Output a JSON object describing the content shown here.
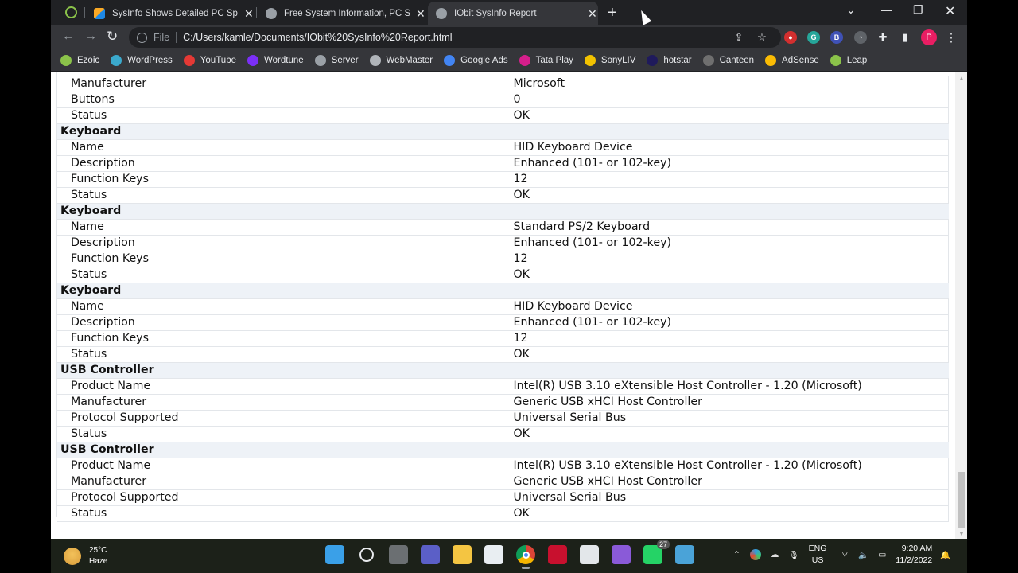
{
  "browser": {
    "tabs": [
      {
        "title": "SysInfo Shows Detailed PC Specs",
        "favicon": "sysinfo-favicon",
        "active": false
      },
      {
        "title": "Free System Information, PC Spe",
        "favicon": "globe-icon",
        "active": false
      },
      {
        "title": "IObit SysInfo Report",
        "favicon": "globe-icon",
        "active": true
      }
    ],
    "new_tab_label": "+",
    "address": {
      "scheme_label": "File",
      "url": "C:/Users/kamle/Documents/IObit%20SysInfo%20Report.html"
    },
    "profile_initial": "P",
    "bookmarks": [
      {
        "label": "Ezoic",
        "icon": "ezoic-icon",
        "color": "#8bc34a"
      },
      {
        "label": "WordPress",
        "icon": "wordpress-icon",
        "color": "#3ba9cc"
      },
      {
        "label": "YouTube",
        "icon": "youtube-icon",
        "color": "#e53935"
      },
      {
        "label": "Wordtune",
        "icon": "wordtune-icon",
        "color": "#7b2ff7"
      },
      {
        "label": "Server",
        "icon": "globe-icon",
        "color": "#9aa0a6"
      },
      {
        "label": "WebMaster",
        "icon": "webmaster-icon",
        "color": "#b0b4b9"
      },
      {
        "label": "Google Ads",
        "icon": "google-ads-icon",
        "color": "#4285f4"
      },
      {
        "label": "Tata Play",
        "icon": "tata-play-icon",
        "color": "#d61f8c"
      },
      {
        "label": "SonyLIV",
        "icon": "sonyliv-icon",
        "color": "#f2c200"
      },
      {
        "label": "hotstar",
        "icon": "hotstar-icon",
        "color": "#1f1a5c"
      },
      {
        "label": "Canteen",
        "icon": "canteen-icon",
        "color": "#6f6f6f"
      },
      {
        "label": "AdSense",
        "icon": "adsense-icon",
        "color": "#fbbc04"
      },
      {
        "label": "Leap",
        "icon": "leap-icon",
        "color": "#8bc34a"
      }
    ]
  },
  "report": {
    "rows": [
      {
        "type": "item",
        "key": "Manufacturer",
        "value": "Microsoft"
      },
      {
        "type": "item",
        "key": "Buttons",
        "value": "0"
      },
      {
        "type": "item",
        "key": "Status",
        "value": "OK"
      },
      {
        "type": "section",
        "title": "Keyboard"
      },
      {
        "type": "item",
        "key": "Name",
        "value": "HID Keyboard Device"
      },
      {
        "type": "item",
        "key": "Description",
        "value": "Enhanced (101- or 102-key)"
      },
      {
        "type": "item",
        "key": "Function Keys",
        "value": "12"
      },
      {
        "type": "item",
        "key": "Status",
        "value": "OK"
      },
      {
        "type": "section",
        "title": "Keyboard"
      },
      {
        "type": "item",
        "key": "Name",
        "value": "Standard PS/2 Keyboard"
      },
      {
        "type": "item",
        "key": "Description",
        "value": "Enhanced (101- or 102-key)"
      },
      {
        "type": "item",
        "key": "Function Keys",
        "value": "12"
      },
      {
        "type": "item",
        "key": "Status",
        "value": "OK"
      },
      {
        "type": "section",
        "title": "Keyboard"
      },
      {
        "type": "item",
        "key": "Name",
        "value": "HID Keyboard Device"
      },
      {
        "type": "item",
        "key": "Description",
        "value": "Enhanced (101- or 102-key)"
      },
      {
        "type": "item",
        "key": "Function Keys",
        "value": "12"
      },
      {
        "type": "item",
        "key": "Status",
        "value": "OK"
      },
      {
        "type": "section",
        "title": "USB Controller"
      },
      {
        "type": "item",
        "key": "Product Name",
        "value": "Intel(R) USB 3.10 eXtensible Host Controller - 1.20 (Microsoft)"
      },
      {
        "type": "item",
        "key": "Manufacturer",
        "value": "Generic USB xHCI Host Controller"
      },
      {
        "type": "item",
        "key": "Protocol Supported",
        "value": "Universal Serial Bus"
      },
      {
        "type": "item",
        "key": "Status",
        "value": "OK"
      },
      {
        "type": "section",
        "title": "USB Controller"
      },
      {
        "type": "item",
        "key": "Product Name",
        "value": "Intel(R) USB 3.10 eXtensible Host Controller - 1.20 (Microsoft)"
      },
      {
        "type": "item",
        "key": "Manufacturer",
        "value": "Generic USB xHCI Host Controller"
      },
      {
        "type": "item",
        "key": "Protocol Supported",
        "value": "Universal Serial Bus"
      },
      {
        "type": "item",
        "key": "Status",
        "value": "OK"
      }
    ]
  },
  "taskbar": {
    "weather": {
      "temp": "25°C",
      "condition": "Haze"
    },
    "apps": [
      {
        "name": "start",
        "glyph": "",
        "color": "#3aa0e8"
      },
      {
        "name": "search",
        "glyph": "",
        "color": "transparent"
      },
      {
        "name": "task-view",
        "glyph": "",
        "color": "#6b6f72"
      },
      {
        "name": "teams-chat",
        "glyph": "",
        "color": "#5b5fc7"
      },
      {
        "name": "file-explorer",
        "glyph": "",
        "color": "#f4c542"
      },
      {
        "name": "microsoft-store",
        "glyph": "",
        "color": "#e9eef2"
      },
      {
        "name": "chrome",
        "glyph": "",
        "color": "#dd4b39",
        "active": true
      },
      {
        "name": "huawei",
        "glyph": "",
        "color": "#c8102e"
      },
      {
        "name": "notepad",
        "glyph": "",
        "color": "#e3e7ea"
      },
      {
        "name": "clipchamp",
        "glyph": "",
        "color": "#8a5ad8"
      },
      {
        "name": "whatsapp",
        "glyph": "",
        "color": "#25d366",
        "badge": "27"
      },
      {
        "name": "remote-desktop",
        "glyph": "",
        "color": "#4aa3d8"
      }
    ],
    "tray": {
      "language_line1": "ENG",
      "language_line2": "US",
      "time": "9:20 AM",
      "date": "11/2/2022"
    }
  }
}
